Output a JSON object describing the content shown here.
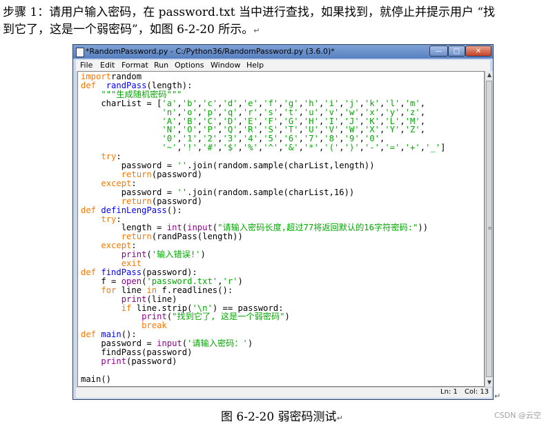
{
  "document": {
    "intro_line1": "步骤 1：请用户输入密码，在 password.txt 当中进行查找，如果找到，就停止并提示用户 “找",
    "intro_line2": "到它了，这是一个弱密码”，如图 6-2-20 所示。",
    "caption": "图 6-2-20  弱密码测试",
    "paragraph_mark": "↵",
    "watermark": "CSDN @云空"
  },
  "window": {
    "title": "*RandomPassword.py - C:/Python36/RandomPassword.py (3.6.0)*",
    "controls": {
      "minimize": "—",
      "maximize": "□",
      "close": "✕"
    },
    "menus": [
      "File",
      "Edit",
      "Format",
      "Run",
      "Options",
      "Window",
      "Help"
    ],
    "status": {
      "line": "Ln: 1",
      "col": "Col: 13"
    }
  },
  "icons": {
    "app": "idle-file-icon",
    "scroll_up": "▲",
    "scroll_down": "▼",
    "grip": "≡"
  },
  "colors": {
    "keyword": "#ff7700",
    "definition": "#0000ff",
    "string": "#00aa00",
    "builtin": "#900090",
    "titlebar": "#5880c0"
  },
  "code_lines": [
    [
      [
        "kw",
        "import"
      ],
      [
        "",
        "random"
      ]
    ],
    [
      [
        "kw",
        "def"
      ],
      [
        "",
        "  "
      ],
      [
        "fn",
        "randPass"
      ],
      [
        "",
        "(length):"
      ]
    ],
    [
      [
        "",
        "    "
      ],
      [
        "st",
        "\"\"\"生成随机密码\"\"\""
      ]
    ],
    [
      [
        "",
        "    charList = ["
      ],
      [
        "st",
        "'a'"
      ],
      [
        "",
        ","
      ],
      [
        "st",
        "'b'"
      ],
      [
        "",
        ","
      ],
      [
        "st",
        "'c'"
      ],
      [
        "",
        ","
      ],
      [
        "st",
        "'d'"
      ],
      [
        "",
        ","
      ],
      [
        "st",
        "'e'"
      ],
      [
        "",
        ","
      ],
      [
        "st",
        "'f'"
      ],
      [
        "",
        ","
      ],
      [
        "st",
        "'g'"
      ],
      [
        "",
        ","
      ],
      [
        "st",
        "'h'"
      ],
      [
        "",
        ","
      ],
      [
        "st",
        "'i'"
      ],
      [
        "",
        ","
      ],
      [
        "st",
        "'j'"
      ],
      [
        "",
        ","
      ],
      [
        "st",
        "'k'"
      ],
      [
        "",
        ","
      ],
      [
        "st",
        "'l'"
      ],
      [
        "",
        ","
      ],
      [
        "st",
        "'m'"
      ],
      [
        "",
        ","
      ]
    ],
    [
      [
        "",
        "                "
      ],
      [
        "st",
        "'n'"
      ],
      [
        "",
        ","
      ],
      [
        "st",
        "'o'"
      ],
      [
        "",
        ","
      ],
      [
        "st",
        "'p'"
      ],
      [
        "",
        ","
      ],
      [
        "st",
        "'q'"
      ],
      [
        "",
        ","
      ],
      [
        "st",
        "'r'"
      ],
      [
        "",
        ","
      ],
      [
        "st",
        "'s'"
      ],
      [
        "",
        ","
      ],
      [
        "st",
        "'t'"
      ],
      [
        "",
        ","
      ],
      [
        "st",
        "'u'"
      ],
      [
        "",
        ","
      ],
      [
        "st",
        "'v'"
      ],
      [
        "",
        ","
      ],
      [
        "st",
        "'w'"
      ],
      [
        "",
        ","
      ],
      [
        "st",
        "'x'"
      ],
      [
        "",
        ","
      ],
      [
        "st",
        "'y'"
      ],
      [
        "",
        ","
      ],
      [
        "st",
        "'z'"
      ],
      [
        "",
        ","
      ]
    ],
    [
      [
        "",
        "                "
      ],
      [
        "st",
        "'A'"
      ],
      [
        "",
        ","
      ],
      [
        "st",
        "'B'"
      ],
      [
        "",
        ","
      ],
      [
        "st",
        "'C'"
      ],
      [
        "",
        ","
      ],
      [
        "st",
        "'D'"
      ],
      [
        "",
        ","
      ],
      [
        "st",
        "'E'"
      ],
      [
        "",
        ","
      ],
      [
        "st",
        "'F'"
      ],
      [
        "",
        ","
      ],
      [
        "st",
        "'G'"
      ],
      [
        "",
        ","
      ],
      [
        "st",
        "'H'"
      ],
      [
        "",
        ","
      ],
      [
        "st",
        "'I'"
      ],
      [
        "",
        ","
      ],
      [
        "st",
        "'J'"
      ],
      [
        "",
        ","
      ],
      [
        "st",
        "'K'"
      ],
      [
        "",
        ","
      ],
      [
        "st",
        "'L'"
      ],
      [
        "",
        ","
      ],
      [
        "st",
        "'M'"
      ],
      [
        "",
        ","
      ]
    ],
    [
      [
        "",
        "                "
      ],
      [
        "st",
        "'N'"
      ],
      [
        "",
        ","
      ],
      [
        "st",
        "'O'"
      ],
      [
        "",
        ","
      ],
      [
        "st",
        "'P'"
      ],
      [
        "",
        ","
      ],
      [
        "st",
        "'Q'"
      ],
      [
        "",
        ","
      ],
      [
        "st",
        "'R'"
      ],
      [
        "",
        ","
      ],
      [
        "st",
        "'S'"
      ],
      [
        "",
        ","
      ],
      [
        "st",
        "'T'"
      ],
      [
        "",
        ","
      ],
      [
        "st",
        "'U'"
      ],
      [
        "",
        ","
      ],
      [
        "st",
        "'V'"
      ],
      [
        "",
        ","
      ],
      [
        "st",
        "'W'"
      ],
      [
        "",
        ","
      ],
      [
        "st",
        "'X'"
      ],
      [
        "",
        ","
      ],
      [
        "st",
        "'Y'"
      ],
      [
        "",
        ","
      ],
      [
        "st",
        "'Z'"
      ],
      [
        "",
        ","
      ]
    ],
    [
      [
        "",
        "                "
      ],
      [
        "st",
        "'0'"
      ],
      [
        "",
        ","
      ],
      [
        "st",
        "'1'"
      ],
      [
        "",
        ","
      ],
      [
        "st",
        "'2'"
      ],
      [
        "",
        ","
      ],
      [
        "st",
        "'3'"
      ],
      [
        "",
        ","
      ],
      [
        "st",
        "'4'"
      ],
      [
        "",
        ","
      ],
      [
        "st",
        "'5'"
      ],
      [
        "",
        ","
      ],
      [
        "st",
        "'6'"
      ],
      [
        "",
        ","
      ],
      [
        "st",
        "'7'"
      ],
      [
        "",
        ","
      ],
      [
        "st",
        "'8'"
      ],
      [
        "",
        ","
      ],
      [
        "st",
        "'9'"
      ],
      [
        "",
        ","
      ],
      [
        "st",
        "'0'"
      ],
      [
        "",
        ","
      ]
    ],
    [
      [
        "",
        "                "
      ],
      [
        "st",
        "'~'"
      ],
      [
        "",
        ","
      ],
      [
        "st",
        "'!'"
      ],
      [
        "",
        ","
      ],
      [
        "st",
        "'#'"
      ],
      [
        "",
        ","
      ],
      [
        "st",
        "'$'"
      ],
      [
        "",
        ","
      ],
      [
        "st",
        "'%'"
      ],
      [
        "",
        ","
      ],
      [
        "st",
        "'^'"
      ],
      [
        "",
        ","
      ],
      [
        "st",
        "'&'"
      ],
      [
        "",
        ","
      ],
      [
        "st",
        "'*'"
      ],
      [
        "",
        ","
      ],
      [
        "st",
        "'('"
      ],
      [
        "",
        ","
      ],
      [
        "st",
        "')'"
      ],
      [
        "",
        ","
      ],
      [
        "st",
        "'-'"
      ],
      [
        "",
        ","
      ],
      [
        "st",
        "'='"
      ],
      [
        "",
        ","
      ],
      [
        "st",
        "'+'"
      ],
      [
        "",
        ","
      ],
      [
        "st",
        "'_'"
      ],
      [
        "",
        "]"
      ]
    ],
    [
      [
        "",
        "    "
      ],
      [
        "kw",
        "try"
      ],
      [
        "",
        ":"
      ]
    ],
    [
      [
        "",
        "        password = "
      ],
      [
        "st",
        "''"
      ],
      [
        "",
        ".join(random.sample(charList,length))"
      ]
    ],
    [
      [
        "",
        "        "
      ],
      [
        "kw",
        "return"
      ],
      [
        "",
        "(password)"
      ]
    ],
    [
      [
        "",
        "    "
      ],
      [
        "kw",
        "except"
      ],
      [
        "",
        ":"
      ]
    ],
    [
      [
        "",
        "        password = "
      ],
      [
        "st",
        "''"
      ],
      [
        "",
        ".join(random.sample(charList,16))"
      ]
    ],
    [
      [
        "",
        "        "
      ],
      [
        "kw",
        "return"
      ],
      [
        "",
        "(password)"
      ]
    ],
    [
      [
        "kw",
        "def"
      ],
      [
        "",
        " "
      ],
      [
        "fn",
        "definLengPass"
      ],
      [
        "",
        "():"
      ]
    ],
    [
      [
        "",
        "    "
      ],
      [
        "kw",
        "try"
      ],
      [
        "",
        ":"
      ]
    ],
    [
      [
        "",
        "        length = "
      ],
      [
        "bi",
        "int"
      ],
      [
        "",
        "("
      ],
      [
        "bi",
        "input"
      ],
      [
        "",
        "("
      ],
      [
        "st",
        "\"请输入密码长度,超过77将返回默认的16字符密码:\""
      ],
      [
        "",
        "))"
      ]
    ],
    [
      [
        "",
        "        "
      ],
      [
        "kw",
        "return"
      ],
      [
        "",
        "(randPass(length))"
      ]
    ],
    [
      [
        "",
        "    "
      ],
      [
        "kw",
        "except"
      ],
      [
        "",
        ":"
      ]
    ],
    [
      [
        "",
        "        "
      ],
      [
        "bi",
        "print"
      ],
      [
        "",
        "("
      ],
      [
        "st",
        "'输入错误!'"
      ],
      [
        "",
        ")"
      ]
    ],
    [
      [
        "",
        "        "
      ],
      [
        "kw",
        "exit"
      ]
    ],
    [
      [
        "kw",
        "def"
      ],
      [
        "",
        " "
      ],
      [
        "fn",
        "findPass"
      ],
      [
        "",
        "(password):"
      ]
    ],
    [
      [
        "",
        "    f = "
      ],
      [
        "bi",
        "open"
      ],
      [
        "",
        "("
      ],
      [
        "st",
        "'password.txt'"
      ],
      [
        "",
        ","
      ],
      [
        "st",
        "'r'"
      ],
      [
        "",
        ")"
      ]
    ],
    [
      [
        "",
        "    "
      ],
      [
        "kw",
        "for"
      ],
      [
        "",
        " line "
      ],
      [
        "kw",
        "in"
      ],
      [
        "",
        " f.readlines():"
      ]
    ],
    [
      [
        "",
        "        "
      ],
      [
        "bi",
        "print"
      ],
      [
        "",
        "(line)"
      ]
    ],
    [
      [
        "",
        "        "
      ],
      [
        "kw",
        "if"
      ],
      [
        "",
        " line.strip("
      ],
      [
        "st",
        "'\\n'"
      ],
      [
        "",
        ") == password:"
      ]
    ],
    [
      [
        "",
        "            "
      ],
      [
        "bi",
        "print"
      ],
      [
        "",
        "("
      ],
      [
        "st",
        "\"找到它了, 这是一个弱密码\""
      ],
      [
        "",
        ")"
      ]
    ],
    [
      [
        "",
        "            "
      ],
      [
        "kw",
        "break"
      ]
    ],
    [
      [
        "kw",
        "def"
      ],
      [
        "",
        " "
      ],
      [
        "fn",
        "main"
      ],
      [
        "",
        "():"
      ]
    ],
    [
      [
        "",
        "    password = "
      ],
      [
        "bi",
        "input"
      ],
      [
        "",
        "("
      ],
      [
        "st",
        "'请输入密码：'"
      ],
      [
        "",
        ")"
      ]
    ],
    [
      [
        "",
        "    findPass(password)"
      ]
    ],
    [
      [
        "",
        "    "
      ],
      [
        "bi",
        "print"
      ],
      [
        "",
        "(password)"
      ]
    ],
    [
      [
        "",
        ""
      ]
    ],
    [
      [
        "",
        "main()"
      ]
    ]
  ]
}
